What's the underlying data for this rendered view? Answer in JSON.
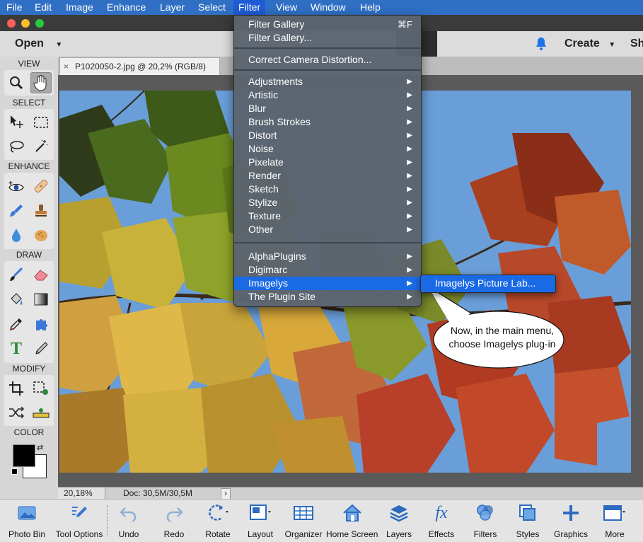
{
  "menubar": {
    "items": [
      "File",
      "Edit",
      "Image",
      "Enhance",
      "Layer",
      "Select",
      "Filter",
      "View",
      "Window",
      "Help"
    ],
    "active": "Filter"
  },
  "appbar": {
    "open": "Open",
    "create": "Create",
    "share": "Sh"
  },
  "toolbox": {
    "sections": {
      "view": "VIEW",
      "select": "SELECT",
      "enhance": "ENHANCE",
      "draw": "DRAW",
      "modify": "MODIFY",
      "color": "COLOR"
    }
  },
  "document": {
    "tab_title": "P1020050-2.jpg @ 20,2% (RGB/8)",
    "close": "×",
    "zoom": "20,18%",
    "doc_size": "Doc: 30,5M/30,5M",
    "status_arrow": "›"
  },
  "filter_menu": {
    "top": [
      {
        "label": "Filter Gallery",
        "shortcut": "⌘F"
      },
      {
        "label": "Filter Gallery..."
      }
    ],
    "mid": [
      {
        "label": "Correct Camera Distortion..."
      }
    ],
    "categories": [
      "Adjustments",
      "Artistic",
      "Blur",
      "Brush Strokes",
      "Distort",
      "Noise",
      "Pixelate",
      "Render",
      "Sketch",
      "Stylize",
      "Texture",
      "Other"
    ],
    "plugins": [
      "AlphaPlugins",
      "Digimarc",
      "Imagelys",
      "The Plugin Site"
    ],
    "highlighted": "Imagelys"
  },
  "submenu": {
    "item": "Imagelys Picture Lab..."
  },
  "callout": {
    "line1": "Now, in the main menu,",
    "line2": "choose Imagelys plug-in"
  },
  "bottombar": {
    "items": [
      {
        "label": "Photo Bin",
        "icon": "photo-bin-icon"
      },
      {
        "label": "Tool Options",
        "icon": "tool-options-icon"
      },
      {
        "label": "Undo",
        "icon": "undo-icon"
      },
      {
        "label": "Redo",
        "icon": "redo-icon"
      },
      {
        "label": "Rotate",
        "icon": "rotate-icon"
      },
      {
        "label": "Layout",
        "icon": "layout-icon"
      },
      {
        "label": "Organizer",
        "icon": "organizer-icon"
      },
      {
        "label": "Home Screen",
        "icon": "home-icon"
      },
      {
        "label": "Layers",
        "icon": "layers-icon"
      },
      {
        "label": "Effects",
        "icon": "fx-icon"
      },
      {
        "label": "Filters",
        "icon": "filters-icon"
      },
      {
        "label": "Styles",
        "icon": "styles-icon"
      },
      {
        "label": "Graphics",
        "icon": "graphics-icon"
      },
      {
        "label": "More",
        "icon": "more-icon"
      }
    ]
  },
  "colors": {
    "menubar": "#2f6fc4",
    "highlight": "#1a6ae6",
    "sky": "#6a9ed8"
  }
}
